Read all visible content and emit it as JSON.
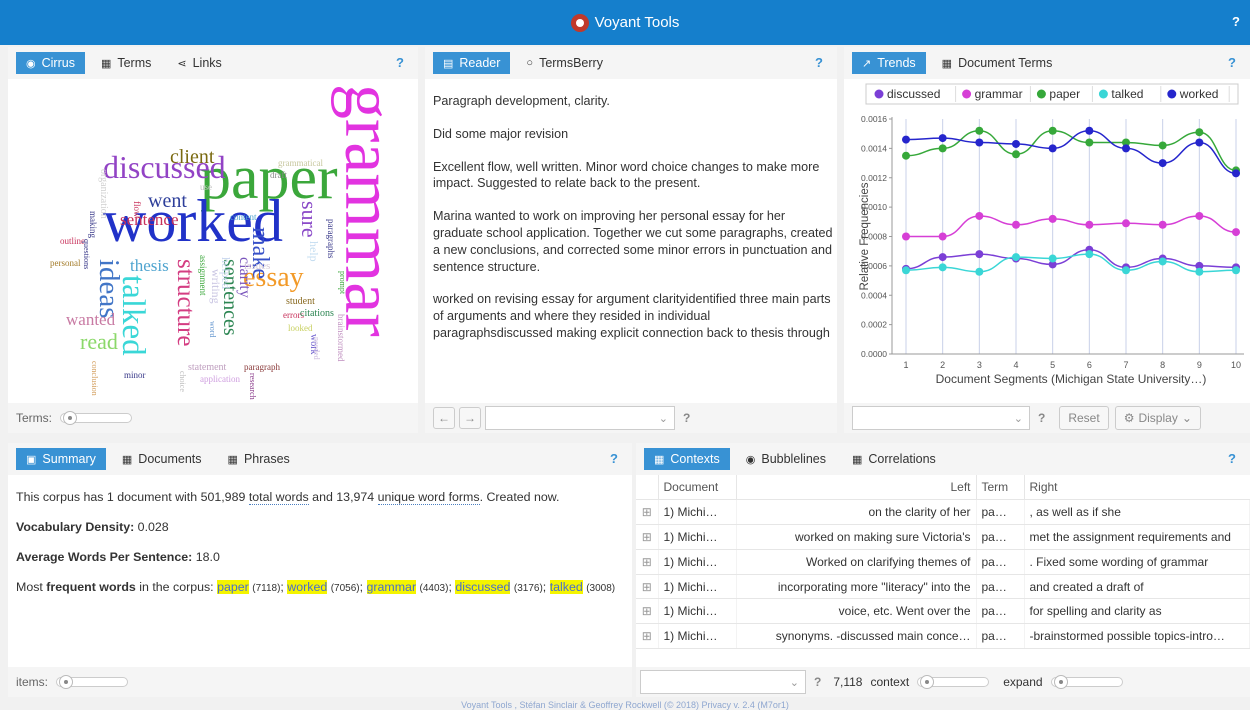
{
  "app": {
    "title": "Voyant Tools",
    "help": "?"
  },
  "cirrus_panel": {
    "tabs": [
      {
        "label": "Cirrus",
        "icon": "eye-icon"
      },
      {
        "label": "Terms",
        "icon": "table-icon"
      },
      {
        "label": "Links",
        "icon": "share-icon"
      }
    ],
    "help": "?",
    "terms_label": "Terms:",
    "words": [
      {
        "text": "grammar",
        "color": "#e233e0",
        "size": 70,
        "rotate": 90
      },
      {
        "text": "paper",
        "color": "#3ba73b",
        "size": 62
      },
      {
        "text": "worked",
        "color": "#2132c8",
        "size": 60
      },
      {
        "text": "discussed",
        "color": "#9243c5",
        "size": 32
      },
      {
        "text": "talked",
        "color": "#3ad7d7",
        "size": 33,
        "rotate": 90
      },
      {
        "text": "ideas",
        "color": "#4276c7",
        "size": 29,
        "rotate": 90
      },
      {
        "text": "essay",
        "color": "#f29a28",
        "size": 28
      },
      {
        "text": "structure",
        "color": "#d43d82",
        "size": 25,
        "rotate": 90
      },
      {
        "text": "make",
        "color": "#3750c8",
        "size": 24,
        "rotate": 90
      },
      {
        "text": "sentences",
        "color": "#2d8653",
        "size": 20,
        "rotate": 90
      },
      {
        "text": "read",
        "color": "#8bd86a",
        "size": 22
      },
      {
        "text": "sure",
        "color": "#8a4ac8",
        "size": 22,
        "rotate": 90
      },
      {
        "text": "went",
        "color": "#2d3e9a",
        "size": 20
      },
      {
        "text": "client",
        "color": "#7a6a10",
        "size": 20
      },
      {
        "text": "sentence",
        "color": "#c8315b",
        "size": 17
      },
      {
        "text": "thesis",
        "color": "#4fa4cf",
        "size": 17
      },
      {
        "text": "wanted",
        "color": "#c87aa3",
        "size": 17
      },
      {
        "text": "clarity",
        "color": "#7a55bc",
        "size": 16,
        "rotate": 90
      },
      {
        "text": "writing",
        "color": "#c7c3e1",
        "size": 12,
        "rotate": 90
      },
      {
        "text": "helped",
        "color": "#c8d6ef",
        "size": 12,
        "rotate": 90
      },
      {
        "text": "assignment",
        "color": "#3ba73b",
        "size": 9,
        "rotate": 90
      },
      {
        "text": "issues",
        "color": "#d4c8d6",
        "size": 11
      },
      {
        "text": "help",
        "color": "#c3dcf0",
        "size": 12,
        "rotate": 90
      },
      {
        "text": "student",
        "color": "#8a6b22",
        "size": 10
      },
      {
        "text": "errors",
        "color": "#c8315b",
        "size": 9
      },
      {
        "text": "citations",
        "color": "#2d8653",
        "size": 10
      },
      {
        "text": "work",
        "color": "#6a5acd",
        "size": 10,
        "rotate": 90
      },
      {
        "text": "outline",
        "color": "#c8315b",
        "size": 9
      },
      {
        "text": "personal",
        "color": "#a47c2a",
        "size": 9
      },
      {
        "text": "making",
        "color": "#3a3a8a",
        "size": 9,
        "rotate": 90
      },
      {
        "text": "questions",
        "color": "#3a3a8a",
        "size": 8,
        "rotate": 90
      },
      {
        "text": "organization",
        "color": "#d0d0d0",
        "size": 10,
        "rotate": 90
      },
      {
        "text": "flow",
        "color": "#c8315b",
        "size": 9,
        "rotate": 90
      },
      {
        "text": "use",
        "color": "#c0c0c0",
        "size": 9
      },
      {
        "text": "content",
        "color": "#4fa4cf",
        "size": 9
      },
      {
        "text": "draft",
        "color": "#8a8a8a",
        "size": 9
      },
      {
        "text": "grammatical",
        "color": "#c8c8a0",
        "size": 9
      },
      {
        "text": "paragraphs",
        "color": "#3a3a8a",
        "size": 9,
        "rotate": 90
      },
      {
        "text": "prompt",
        "color": "#3ba73b",
        "size": 8,
        "rotate": 90
      },
      {
        "text": "brainstormed",
        "color": "#c090c0",
        "size": 9,
        "rotate": 90
      },
      {
        "text": "needed",
        "color": "#d0c0e0",
        "size": 8,
        "rotate": 90
      },
      {
        "text": "looked",
        "color": "#c8d060",
        "size": 9
      },
      {
        "text": "minor",
        "color": "#3a3a8a",
        "size": 9
      },
      {
        "text": "conclusion",
        "color": "#d4a060",
        "size": 8,
        "rotate": 90
      },
      {
        "text": "statement",
        "color": "#c0a0c0",
        "size": 10
      },
      {
        "text": "paragraph",
        "color": "#8a3a3a",
        "size": 9
      },
      {
        "text": "application",
        "color": "#d0a0e0",
        "size": 9
      },
      {
        "text": "research",
        "color": "#8a3a8a",
        "size": 8,
        "rotate": 90
      },
      {
        "text": "choice",
        "color": "#c0c0c0",
        "size": 8,
        "rotate": 90
      },
      {
        "text": "word",
        "color": "#6a9ad0",
        "size": 8,
        "rotate": 90
      }
    ]
  },
  "reader_panel": {
    "tabs": [
      {
        "label": "Reader",
        "icon": "file-icon"
      },
      {
        "label": "TermsBerry",
        "icon": "circle-icon"
      }
    ],
    "help": "?",
    "paragraphs": [
      "Paragraph development, clarity.",
      "Did some major revision",
      "Excellent flow, well written. Minor word choice changes to make more impact. Suggested to relate back to the present.",
      "Marina wanted to work on improving her personal essay for her graduate school application. Together we cut some paragraphs, created a new conclusions, and corrected some minor errors in punctuation and sentence structure.",
      "worked on revising essay for argument clarityidentified three main parts of arguments and where they resided in individual paragraphsdiscussed making explicit connection back to thesis through topic sentences and concluding sentencesrevised grammar"
    ],
    "help_small": "?"
  },
  "trends_panel": {
    "tabs": [
      {
        "label": "Trends",
        "icon": "chart-line-icon"
      },
      {
        "label": "Document Terms",
        "icon": "table-icon"
      }
    ],
    "help": "?",
    "reset_label": "Reset",
    "display_label": "Display",
    "help_small": "?"
  },
  "chart_data": {
    "type": "line",
    "x": [
      1,
      2,
      3,
      4,
      5,
      6,
      7,
      8,
      9,
      10
    ],
    "xlabel": "Document Segments (Michigan State University…)",
    "ylabel": "Relative Frequencies",
    "ylim": [
      0,
      0.0016
    ],
    "yticks": [
      "0.0000",
      "0.0002",
      "0.0004",
      "0.0006",
      "0.0008",
      "0.0010",
      "0.0012",
      "0.0014",
      "0.0016"
    ],
    "legend_position": "top",
    "series": [
      {
        "name": "discussed",
        "color": "#7b3fd6",
        "values": [
          0.00058,
          0.00066,
          0.00068,
          0.00065,
          0.00061,
          0.00071,
          0.00059,
          0.00065,
          0.0006,
          0.00059
        ]
      },
      {
        "name": "grammar",
        "color": "#d63fd6",
        "values": [
          0.0008,
          0.0008,
          0.00094,
          0.00088,
          0.00092,
          0.00088,
          0.00089,
          0.00088,
          0.00094,
          0.00083
        ]
      },
      {
        "name": "paper",
        "color": "#36a83a",
        "values": [
          0.00135,
          0.0014,
          0.00152,
          0.00136,
          0.00152,
          0.00144,
          0.00144,
          0.00142,
          0.00151,
          0.00125
        ]
      },
      {
        "name": "talked",
        "color": "#3ad6d6",
        "values": [
          0.00057,
          0.00059,
          0.00056,
          0.00066,
          0.00065,
          0.00068,
          0.00057,
          0.00063,
          0.00056,
          0.00057
        ]
      },
      {
        "name": "worked",
        "color": "#2525cc",
        "values": [
          0.00146,
          0.00147,
          0.00144,
          0.00143,
          0.0014,
          0.00152,
          0.0014,
          0.0013,
          0.00144,
          0.00123
        ]
      }
    ]
  },
  "summary_panel": {
    "tabs": [
      {
        "label": "Summary",
        "icon": "summary-icon"
      },
      {
        "label": "Documents",
        "icon": "table-icon"
      },
      {
        "label": "Phrases",
        "icon": "table-icon"
      }
    ],
    "help": "?",
    "line1_pre": "This corpus has 1 document with 501,989 ",
    "line1_link": "total words",
    "line1_mid": " and 13,974 ",
    "line1_link2": "unique word forms",
    "line1_post": ". Created now.",
    "density_label": "Vocabulary Density:",
    "density_value": "0.028",
    "avg_label": "Average Words Per Sentence:",
    "avg_value": "18.0",
    "frequent_pre": "Most ",
    "frequent_bold": "frequent words",
    "frequent_post": " in the corpus: ",
    "frequent": [
      {
        "word": "paper",
        "count": "(7118)"
      },
      {
        "word": "worked",
        "count": "(7056)"
      },
      {
        "word": "grammar",
        "count": "(4403)"
      },
      {
        "word": "discussed",
        "count": "(3176)"
      },
      {
        "word": "talked",
        "count": "(3008)"
      }
    ],
    "items_label": "items:"
  },
  "contexts_panel": {
    "tabs": [
      {
        "label": "Contexts",
        "icon": "table-icon"
      },
      {
        "label": "Bubblelines",
        "icon": "eye-icon"
      },
      {
        "label": "Correlations",
        "icon": "table-icon"
      }
    ],
    "help": "?",
    "columns": [
      "Document",
      "Left",
      "Term",
      "Right"
    ],
    "rows": [
      {
        "doc": "1) Michi…",
        "left": "on the clarity of her",
        "term": "pa…",
        "right": ", as well as if she"
      },
      {
        "doc": "1) Michi…",
        "left": "worked on making sure Victoria's",
        "term": "pa…",
        "right": "met the assignment requirements and"
      },
      {
        "doc": "1) Michi…",
        "left": "Worked on clarifying themes of",
        "term": "pa…",
        "right": ". Fixed some wording of grammar"
      },
      {
        "doc": "1) Michi…",
        "left": "incorporating more \"literacy\" into the",
        "term": "pa…",
        "right": "and created a draft of"
      },
      {
        "doc": "1) Michi…",
        "left": "voice, etc. Went over the",
        "term": "pa…",
        "right": "for spelling and clarity as"
      },
      {
        "doc": "1) Michi…",
        "left": "synonyms. -discussed main conce…",
        "term": "pa…",
        "right": "-brainstormed possible topics-intro…"
      }
    ],
    "count": "7,118",
    "context_label": "context",
    "expand_label": "expand",
    "help_small": "?"
  },
  "footer": {
    "text": "Voyant Tools , Stéfan Sinclair & Geoffrey Rockwell (© 2018) Privacy v. 2.4 (M7or1)"
  }
}
